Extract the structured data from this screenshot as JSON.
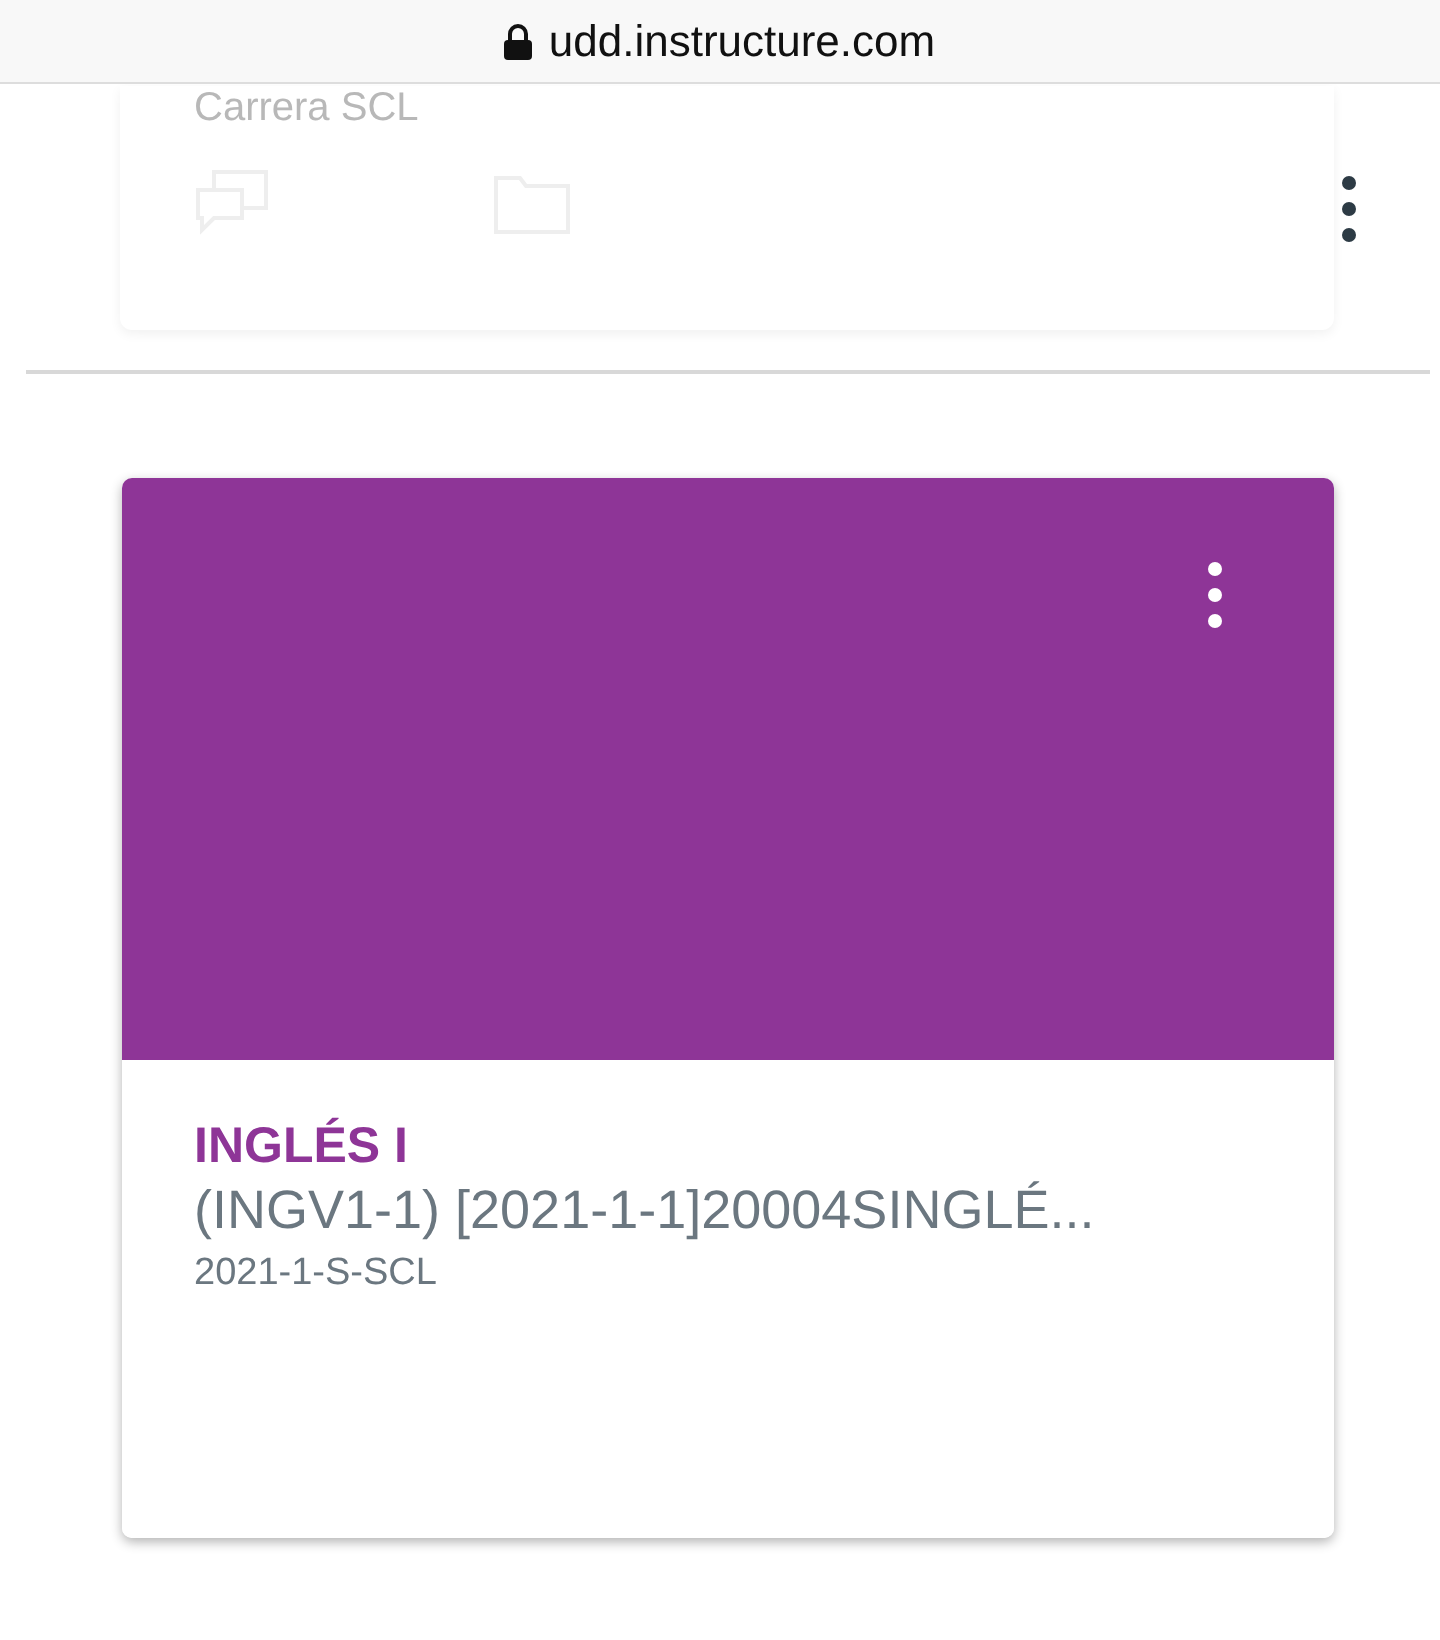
{
  "browser": {
    "address": "udd.instructure.com",
    "secure": true
  },
  "cards": [
    {
      "title": "Carrera SCL",
      "faded": true,
      "color": "#ffffff",
      "icons": [
        {
          "kind": "discussion"
        },
        {
          "kind": "folder"
        }
      ]
    },
    {
      "title": "INGLÉS I",
      "subtitle": "(INGV1-1) [2021-1-1]20004SINGLÉ...",
      "term": "2021-1-S-SCL",
      "faded": false,
      "color": "#8e3597"
    }
  ]
}
